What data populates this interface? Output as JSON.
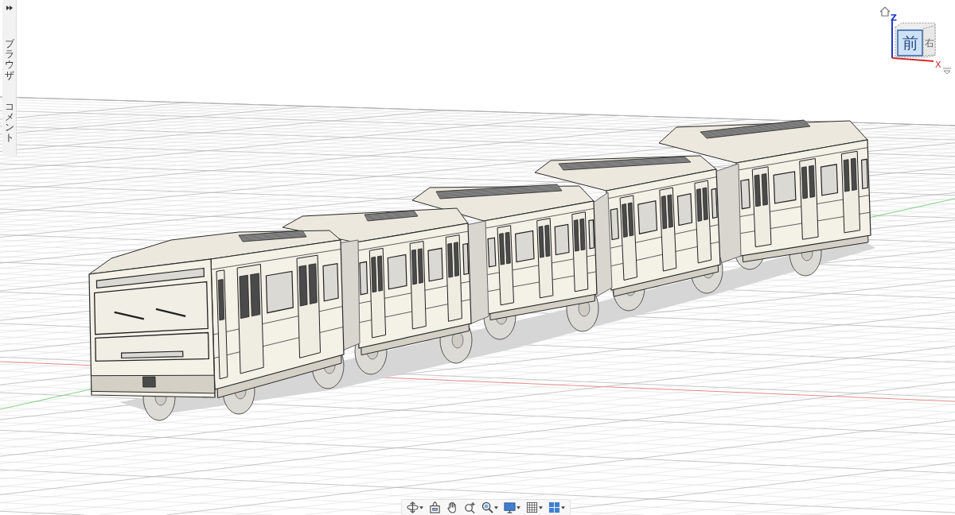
{
  "side_panel": {
    "tabs": [
      {
        "label": "ブラウザ"
      },
      {
        "label": "コメント"
      }
    ]
  },
  "view_cube": {
    "front_label": "前",
    "right_label": "右",
    "z_label": "Z",
    "x_label": "X"
  },
  "navigation_toolbar": {
    "tools": [
      {
        "kind": "orbit",
        "dropdown": true
      },
      {
        "kind": "look_at",
        "dropdown": false
      },
      {
        "kind": "pan",
        "dropdown": false
      },
      {
        "kind": "zoom_window",
        "dropdown": false
      },
      {
        "kind": "zoom",
        "dropdown": true
      },
      {
        "kind": "display",
        "dropdown": true
      },
      {
        "kind": "grid",
        "dropdown": true
      },
      {
        "kind": "viewports",
        "dropdown": true
      }
    ]
  }
}
